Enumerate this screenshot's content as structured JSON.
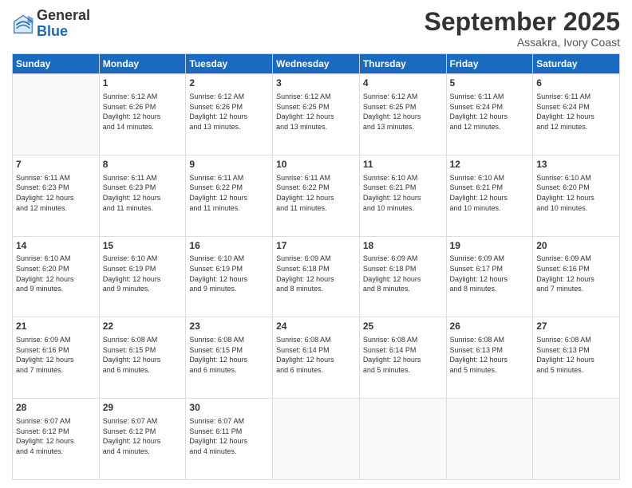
{
  "logo": {
    "general": "General",
    "blue": "Blue"
  },
  "title": "September 2025",
  "location": "Assakra, Ivory Coast",
  "days_of_week": [
    "Sunday",
    "Monday",
    "Tuesday",
    "Wednesday",
    "Thursday",
    "Friday",
    "Saturday"
  ],
  "weeks": [
    [
      {
        "day": "",
        "content": ""
      },
      {
        "day": "1",
        "content": "Sunrise: 6:12 AM\nSunset: 6:26 PM\nDaylight: 12 hours\nand 14 minutes."
      },
      {
        "day": "2",
        "content": "Sunrise: 6:12 AM\nSunset: 6:26 PM\nDaylight: 12 hours\nand 13 minutes."
      },
      {
        "day": "3",
        "content": "Sunrise: 6:12 AM\nSunset: 6:25 PM\nDaylight: 12 hours\nand 13 minutes."
      },
      {
        "day": "4",
        "content": "Sunrise: 6:12 AM\nSunset: 6:25 PM\nDaylight: 12 hours\nand 13 minutes."
      },
      {
        "day": "5",
        "content": "Sunrise: 6:11 AM\nSunset: 6:24 PM\nDaylight: 12 hours\nand 12 minutes."
      },
      {
        "day": "6",
        "content": "Sunrise: 6:11 AM\nSunset: 6:24 PM\nDaylight: 12 hours\nand 12 minutes."
      }
    ],
    [
      {
        "day": "7",
        "content": "Sunrise: 6:11 AM\nSunset: 6:23 PM\nDaylight: 12 hours\nand 12 minutes."
      },
      {
        "day": "8",
        "content": "Sunrise: 6:11 AM\nSunset: 6:23 PM\nDaylight: 12 hours\nand 11 minutes."
      },
      {
        "day": "9",
        "content": "Sunrise: 6:11 AM\nSunset: 6:22 PM\nDaylight: 12 hours\nand 11 minutes."
      },
      {
        "day": "10",
        "content": "Sunrise: 6:11 AM\nSunset: 6:22 PM\nDaylight: 12 hours\nand 11 minutes."
      },
      {
        "day": "11",
        "content": "Sunrise: 6:10 AM\nSunset: 6:21 PM\nDaylight: 12 hours\nand 10 minutes."
      },
      {
        "day": "12",
        "content": "Sunrise: 6:10 AM\nSunset: 6:21 PM\nDaylight: 12 hours\nand 10 minutes."
      },
      {
        "day": "13",
        "content": "Sunrise: 6:10 AM\nSunset: 6:20 PM\nDaylight: 12 hours\nand 10 minutes."
      }
    ],
    [
      {
        "day": "14",
        "content": "Sunrise: 6:10 AM\nSunset: 6:20 PM\nDaylight: 12 hours\nand 9 minutes."
      },
      {
        "day": "15",
        "content": "Sunrise: 6:10 AM\nSunset: 6:19 PM\nDaylight: 12 hours\nand 9 minutes."
      },
      {
        "day": "16",
        "content": "Sunrise: 6:10 AM\nSunset: 6:19 PM\nDaylight: 12 hours\nand 9 minutes."
      },
      {
        "day": "17",
        "content": "Sunrise: 6:09 AM\nSunset: 6:18 PM\nDaylight: 12 hours\nand 8 minutes."
      },
      {
        "day": "18",
        "content": "Sunrise: 6:09 AM\nSunset: 6:18 PM\nDaylight: 12 hours\nand 8 minutes."
      },
      {
        "day": "19",
        "content": "Sunrise: 6:09 AM\nSunset: 6:17 PM\nDaylight: 12 hours\nand 8 minutes."
      },
      {
        "day": "20",
        "content": "Sunrise: 6:09 AM\nSunset: 6:16 PM\nDaylight: 12 hours\nand 7 minutes."
      }
    ],
    [
      {
        "day": "21",
        "content": "Sunrise: 6:09 AM\nSunset: 6:16 PM\nDaylight: 12 hours\nand 7 minutes."
      },
      {
        "day": "22",
        "content": "Sunrise: 6:08 AM\nSunset: 6:15 PM\nDaylight: 12 hours\nand 6 minutes."
      },
      {
        "day": "23",
        "content": "Sunrise: 6:08 AM\nSunset: 6:15 PM\nDaylight: 12 hours\nand 6 minutes."
      },
      {
        "day": "24",
        "content": "Sunrise: 6:08 AM\nSunset: 6:14 PM\nDaylight: 12 hours\nand 6 minutes."
      },
      {
        "day": "25",
        "content": "Sunrise: 6:08 AM\nSunset: 6:14 PM\nDaylight: 12 hours\nand 5 minutes."
      },
      {
        "day": "26",
        "content": "Sunrise: 6:08 AM\nSunset: 6:13 PM\nDaylight: 12 hours\nand 5 minutes."
      },
      {
        "day": "27",
        "content": "Sunrise: 6:08 AM\nSunset: 6:13 PM\nDaylight: 12 hours\nand 5 minutes."
      }
    ],
    [
      {
        "day": "28",
        "content": "Sunrise: 6:07 AM\nSunset: 6:12 PM\nDaylight: 12 hours\nand 4 minutes."
      },
      {
        "day": "29",
        "content": "Sunrise: 6:07 AM\nSunset: 6:12 PM\nDaylight: 12 hours\nand 4 minutes."
      },
      {
        "day": "30",
        "content": "Sunrise: 6:07 AM\nSunset: 6:11 PM\nDaylight: 12 hours\nand 4 minutes."
      },
      {
        "day": "",
        "content": ""
      },
      {
        "day": "",
        "content": ""
      },
      {
        "day": "",
        "content": ""
      },
      {
        "day": "",
        "content": ""
      }
    ]
  ]
}
